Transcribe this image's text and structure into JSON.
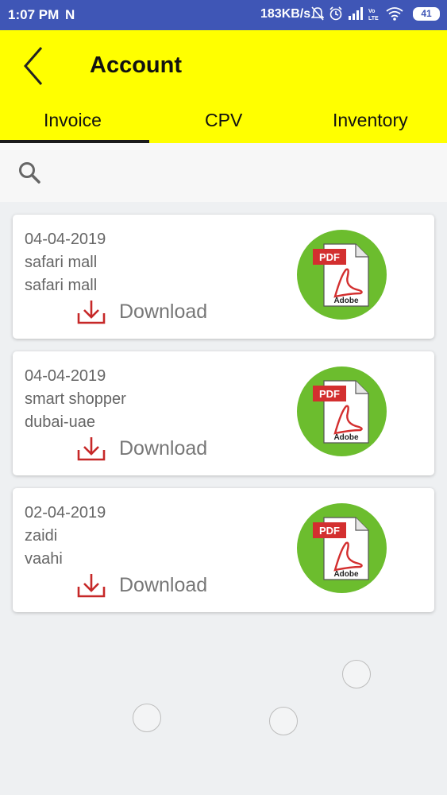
{
  "status_bar": {
    "time": "1:07 PM",
    "notification_icon": "N",
    "speed": "183KB/s",
    "battery": "41",
    "icons": [
      "mute-icon",
      "alarm-icon",
      "signal-icon",
      "volte-icon",
      "wifi-icon"
    ]
  },
  "header": {
    "title": "Account",
    "tabs": [
      {
        "label": "Invoice",
        "active": true
      },
      {
        "label": "CPV",
        "active": false
      },
      {
        "label": "Inventory",
        "active": false
      }
    ]
  },
  "invoices": [
    {
      "date": "04-04-2019",
      "line1": "safari mall",
      "line2": "safari mall",
      "download_label": "Download",
      "badge": "PDF",
      "brand": "Adobe"
    },
    {
      "date": "04-04-2019",
      "line1": "smart shopper",
      "line2": "dubai-uae",
      "download_label": "Download",
      "badge": "PDF",
      "brand": "Adobe"
    },
    {
      "date": "02-04-2019",
      "line1": "zaidi",
      "line2": "vaahi",
      "download_label": "Download",
      "badge": "PDF",
      "brand": "Adobe"
    }
  ],
  "colors": {
    "status_bar": "#3f56b6",
    "app_bar": "#ffff00",
    "pdf_circle": "#6cbd2e",
    "download_icon": "#c62828"
  }
}
